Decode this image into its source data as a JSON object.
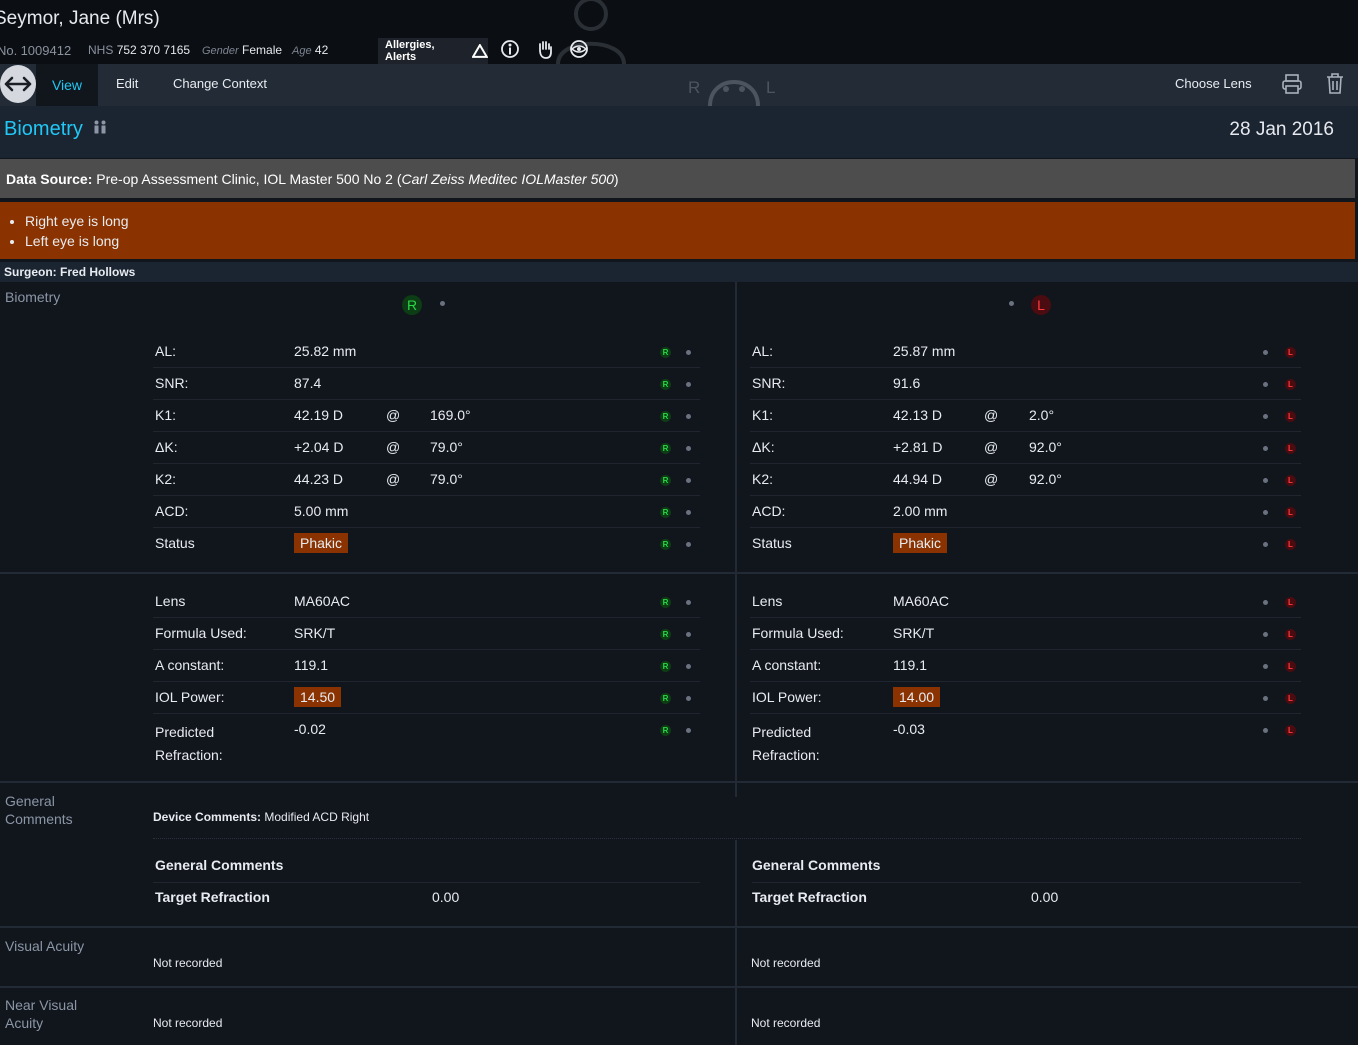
{
  "patient": {
    "name": "Seymor, Jane (Mrs)",
    "hosp_no_label": "No.",
    "hosp_no": "1009412",
    "nhs_label": "NHS",
    "nhs": "752 370 7165",
    "gender_label": "Gender",
    "gender": "Female",
    "age_label": "Age",
    "age": "42",
    "alerts_label": "Allergies, Alerts"
  },
  "toolbar": {
    "view": "View",
    "edit": "Edit",
    "change_context": "Change Context",
    "choose_lens": "Choose Lens",
    "eye_r": "R",
    "eye_l": "L"
  },
  "page": {
    "title": "Biometry",
    "date": "28 Jan 2016",
    "data_source_label": "Data Source:",
    "data_source": "Pre-op Assessment Clinic, IOL Master 500 No 2 (",
    "data_source_device": "Carl Zeiss Meditec IOLMaster 500",
    "data_source_end": ")",
    "warnings": [
      "Right eye is long",
      "Left eye is long"
    ],
    "surgeon_label": "Surgeon:",
    "surgeon": "Fred Hollows"
  },
  "sections": {
    "biometry": "Biometry",
    "general_comments": [
      "General",
      "Comments"
    ],
    "visual_acuity": "Visual Acuity",
    "near_visual_acuity": [
      "Near Visual",
      "Acuity"
    ]
  },
  "labels": {
    "al": "AL:",
    "snr": "SNR:",
    "k1": "K1:",
    "dk": "ΔK:",
    "k2": "K2:",
    "acd": "ACD:",
    "status": "Status",
    "at": "@",
    "lens": "Lens",
    "formula": "Formula  Used:",
    "a_constant": "A constant:",
    "iol_power": "IOL Power:",
    "predicted": [
      "Predicted",
      "Refraction:"
    ],
    "general_comments": "General Comments",
    "target_refraction": "Target Refraction",
    "device_comments_label": "Device Comments:",
    "device_comments": "Modified ACD Right",
    "not_recorded": "Not recorded"
  },
  "right": {
    "al": "25.82 mm",
    "snr": "87.4",
    "k1": "42.19 D",
    "k1_axis": "169.0°",
    "dk": "+2.04 D",
    "dk_axis": "79.0°",
    "k2": "44.23 D",
    "k2_axis": "79.0°",
    "acd": "5.00 mm",
    "status": "Phakic",
    "lens": "MA60AC",
    "formula": "SRK/T",
    "a_constant": "119.1",
    "iol_power": "14.50",
    "predicted": "-0.02",
    "target_refraction": "0.00",
    "visual_acuity": "Not recorded",
    "near_visual_acuity": "Not recorded"
  },
  "left": {
    "al": "25.87 mm",
    "snr": "91.6",
    "k1": "42.13 D",
    "k1_axis": "2.0°",
    "dk": "+2.81 D",
    "dk_axis": "92.0°",
    "k2": "44.94 D",
    "k2_axis": "92.0°",
    "acd": "2.00 mm",
    "status": "Phakic",
    "lens": "MA60AC",
    "formula": "SRK/T",
    "a_constant": "119.1",
    "iol_power": "14.00",
    "predicted": "-0.03",
    "target_refraction": "0.00",
    "visual_acuity": "Not recorded",
    "near_visual_acuity": "Not recorded"
  },
  "colors": {
    "accent": "#21c7f5",
    "warning": "#8a3300",
    "right_eye": "#2ad846",
    "left_eye": "#ff3b3b"
  },
  "icons": [
    "swap-arrows-icon",
    "alert-triangle-icon",
    "info-icon",
    "hand-icon",
    "eye-icon",
    "print-icon",
    "trash-icon",
    "family-icon"
  ]
}
